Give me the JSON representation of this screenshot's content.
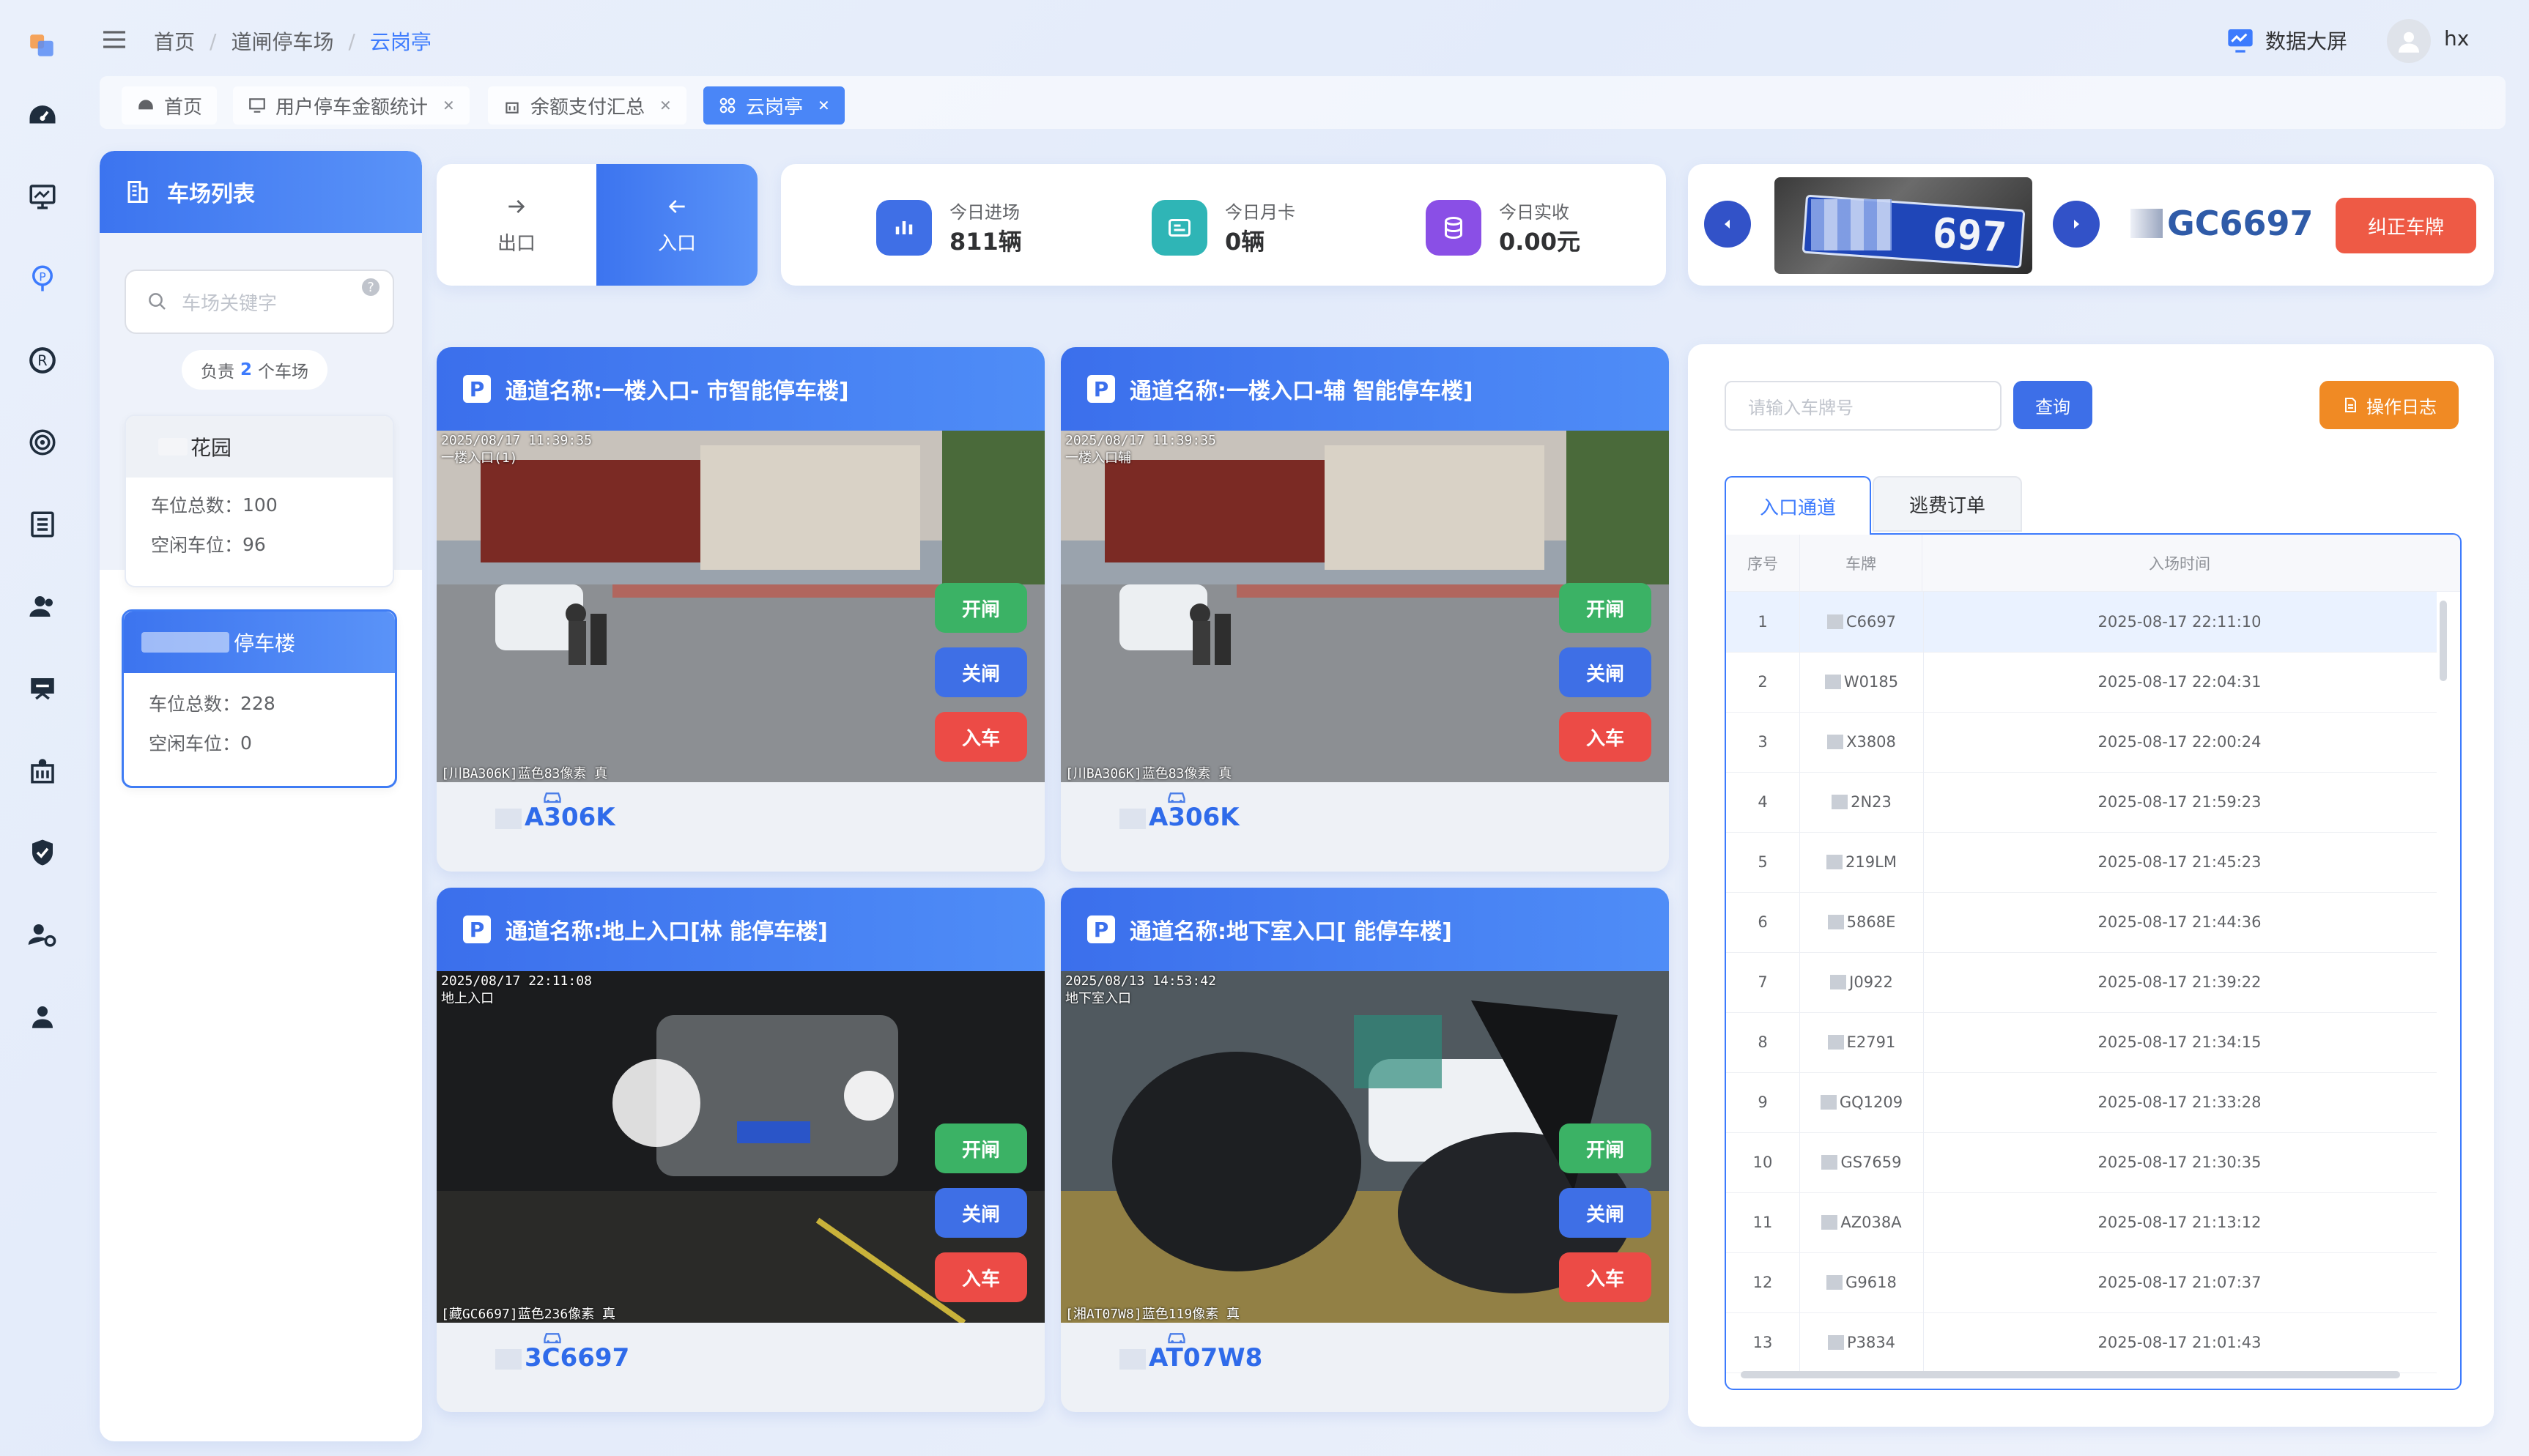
{
  "header": {
    "breadcrumb": [
      "首页",
      "道闸停车场",
      "云岗亭"
    ],
    "screen_btn": "数据大屏",
    "user": "hx"
  },
  "tabs": [
    {
      "label": "首页",
      "closable": false
    },
    {
      "label": "用户停车金额统计",
      "closable": true
    },
    {
      "label": "余额支付汇总",
      "closable": true
    },
    {
      "label": "云岗亭",
      "closable": true,
      "active": true
    }
  ],
  "lot_list": {
    "title": "车场列表",
    "search_placeholder": "车场关键字",
    "charge_prefix": "负责",
    "charge_count": "2",
    "charge_suffix": "个车场",
    "lots": [
      {
        "name": "花园",
        "total_label": "车位总数：",
        "total": "100",
        "free_label": "空闲车位：",
        "free": "96"
      },
      {
        "name": "停车楼",
        "total_label": "车位总数：",
        "total": "228",
        "free_label": "空闲车位：",
        "free": "0"
      }
    ]
  },
  "direction": {
    "out": "出口",
    "in": "入口"
  },
  "stats": [
    {
      "label": "今日进场",
      "value": "811辆",
      "color": "#3f6fe6",
      "icon": "bar-chart-icon"
    },
    {
      "label": "今日月卡",
      "value": "0辆",
      "color": "#2fb5b6",
      "icon": "card-icon"
    },
    {
      "label": "今日实收",
      "value": "0.00元",
      "color": "#8a4fe6",
      "icon": "coins-icon"
    }
  ],
  "plate_viewer": {
    "plate_text": "GC6697",
    "plate_image_text": "697",
    "correct_btn": "纠正车牌"
  },
  "channels": [
    {
      "title": "通道名称:一楼入口-  市智能停车楼]",
      "ts": "2025/08/17 11:39:35",
      "ts2": "一楼入口(1)",
      "foot": "[川BA306K]蓝色83像素 真",
      "plate": "A306K",
      "scene": "day"
    },
    {
      "title": "通道名称:一楼入口-辅  智能停车楼]",
      "ts": "2025/08/17 11:39:35",
      "ts2": "一楼入口辅",
      "foot": "[川BA306K]蓝色83像素 真",
      "plate": "A306K",
      "scene": "day"
    },
    {
      "title": "通道名称:地上入口[林  能停车楼]",
      "ts": "2025/08/17 22:11:08",
      "ts2": "地上入口",
      "foot": "[藏GC6697]蓝色236像素 真",
      "plate": "3C6697",
      "scene": "night"
    },
    {
      "title": "通道名称:地下室入口[  能停车楼]",
      "ts": "2025/08/13 14:53:42",
      "ts2": "地下室入口",
      "foot": "[湘AT07W8]蓝色119像素 真",
      "plate": "AT07W8",
      "scene": "garage"
    }
  ],
  "channel_buttons": {
    "open": "开闸",
    "close": "关闸",
    "enter": "入车"
  },
  "search": {
    "placeholder": "请输入车牌号",
    "query": "查询",
    "log": "操作日志"
  },
  "record_tabs": [
    "入口通道",
    "逃费订单"
  ],
  "table": {
    "headers": [
      "序号",
      "车牌",
      "入场时间"
    ],
    "rows": [
      [
        "1",
        "C6697",
        "2025-08-17 22:11:10"
      ],
      [
        "2",
        "W0185",
        "2025-08-17 22:04:31"
      ],
      [
        "3",
        "X3808",
        "2025-08-17 22:00:24"
      ],
      [
        "4",
        "2N23",
        "2025-08-17 21:59:23"
      ],
      [
        "5",
        "219LM",
        "2025-08-17 21:45:23"
      ],
      [
        "6",
        "5868E",
        "2025-08-17 21:44:36"
      ],
      [
        "7",
        "J0922",
        "2025-08-17 21:39:22"
      ],
      [
        "8",
        "E2791",
        "2025-08-17 21:34:15"
      ],
      [
        "9",
        "GQ1209",
        "2025-08-17 21:33:28"
      ],
      [
        "10",
        "GS7659",
        "2025-08-17 21:30:35"
      ],
      [
        "11",
        "AZ038A",
        "2025-08-17 21:13:12"
      ],
      [
        "12",
        "G9618",
        "2025-08-17 21:07:37"
      ],
      [
        "13",
        "P3834",
        "2025-08-17 21:01:43"
      ]
    ]
  },
  "colors": {
    "primary": "#3d7bfd",
    "open": "#3bb265",
    "close": "#3e6fe6",
    "enter": "#ec4b46",
    "log": "#f08a24",
    "correct": "#ee5a45"
  }
}
